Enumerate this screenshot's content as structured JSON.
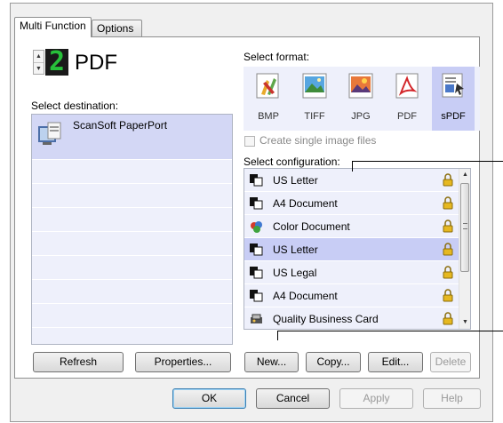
{
  "tabs": [
    {
      "label": "Multi Function"
    },
    {
      "label": "Options"
    }
  ],
  "format_display": {
    "digit": "2",
    "name": "PDF"
  },
  "labels": {
    "select_destination": "Select destination:",
    "select_format": "Select format:",
    "select_configuration": "Select configuration:",
    "create_single_image": "Create single image files"
  },
  "destinations": [
    {
      "label": "ScanSoft PaperPort",
      "icon": "paperport-icon",
      "selected": true
    }
  ],
  "formats": [
    {
      "label": "BMP",
      "icon": "bmp-icon"
    },
    {
      "label": "TIFF",
      "icon": "tiff-icon"
    },
    {
      "label": "JPG",
      "icon": "jpg-icon"
    },
    {
      "label": "PDF",
      "icon": "pdf-icon"
    },
    {
      "label": "sPDF",
      "icon": "spdf-icon",
      "selected": true
    }
  ],
  "configurations": [
    {
      "label": "US Letter",
      "icon": "bw-document-icon",
      "locked": true
    },
    {
      "label": "A4 Document",
      "icon": "bw-document-icon",
      "locked": true
    },
    {
      "label": "Color Document",
      "icon": "color-document-icon",
      "locked": true
    },
    {
      "label": "US Letter",
      "icon": "bw-document-icon",
      "locked": true,
      "selected": true
    },
    {
      "label": "US Legal",
      "icon": "bw-document-icon",
      "locked": true
    },
    {
      "label": "A4 Document",
      "icon": "bw-document-icon",
      "locked": true
    },
    {
      "label": "Quality Business Card",
      "icon": "business-card-icon",
      "locked": true
    }
  ],
  "buttons": {
    "refresh": "Refresh",
    "properties": "Properties...",
    "new": "New...",
    "copy": "Copy...",
    "edit": "Edit...",
    "delete": "Delete",
    "ok": "OK",
    "cancel": "Cancel",
    "apply": "Apply",
    "help": "Help"
  },
  "colors": {
    "digit": "#27c13a",
    "list_background": "#eef0fb",
    "selection": "#c8cdf5"
  }
}
